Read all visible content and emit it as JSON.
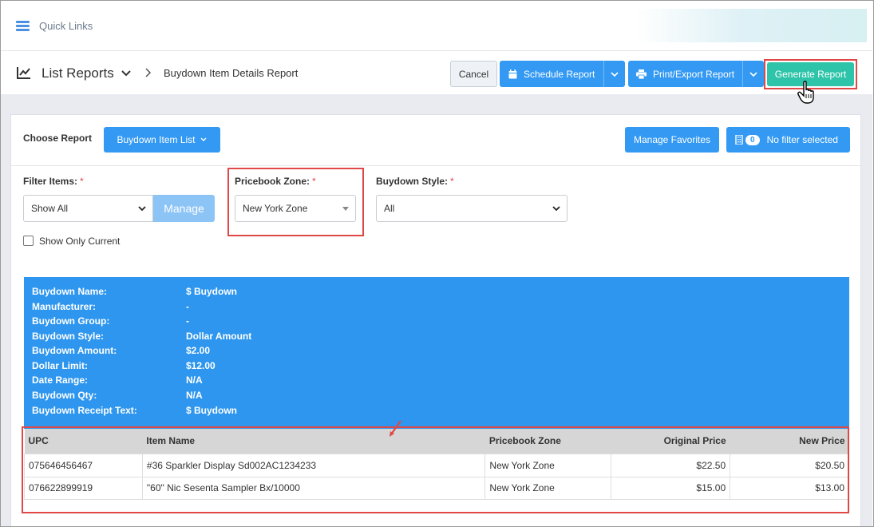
{
  "quick_links": {
    "label": "Quick Links"
  },
  "header": {
    "title": "List Reports",
    "breadcrumb": "Buydown Item Details Report",
    "cancel_label": "Cancel",
    "schedule_label": "Schedule Report",
    "print_label": "Print/Export Report",
    "generate_label": "Generate Report"
  },
  "toolbar": {
    "choose_label": "Choose Report",
    "choose_value": "Buydown Item List",
    "favorites_label": "Manage Favorites",
    "filter_count": "0",
    "filter_label": "No filter selected"
  },
  "filters": {
    "filter_items_label": "Filter Items:",
    "filter_items_value": "Show All",
    "manage_label": "Manage",
    "pricebook_zone_label": "Pricebook Zone:",
    "pricebook_zone_value": "New York Zone",
    "buydown_style_label": "Buydown Style:",
    "buydown_style_value": "All",
    "required_mark": "*",
    "show_only_current_label": "Show Only Current"
  },
  "buydown_info": [
    {
      "label": "Buydown Name:",
      "value": "$ Buydown"
    },
    {
      "label": "Manufacturer:",
      "value": "-"
    },
    {
      "label": "Buydown Group:",
      "value": "-"
    },
    {
      "label": "Buydown Style:",
      "value": "Dollar Amount"
    },
    {
      "label": "Buydown Amount:",
      "value": "$2.00"
    },
    {
      "label": "Dollar Limit:",
      "value": "$12.00"
    },
    {
      "label": "Date Range:",
      "value": "N/A"
    },
    {
      "label": "Buydown Qty:",
      "value": "N/A"
    },
    {
      "label": "Buydown Receipt Text:",
      "value": "$ Buydown"
    }
  ],
  "table": {
    "columns": [
      "UPC",
      "Item Name",
      "Pricebook Zone",
      "Original Price",
      "New Price"
    ],
    "rows": [
      [
        "075646456467",
        "#36 Sparkler Display Sd002AC1234233",
        "New York Zone",
        "$22.50",
        "$20.50"
      ],
      [
        "076622899919",
        "\"60\" Nic Sesenta Sampler Bx/10000",
        "New York Zone",
        "$15.00",
        "$13.00"
      ]
    ]
  },
  "colors": {
    "primary": "#3399f3",
    "generate": "#2ec4a9",
    "highlight": "#e04848",
    "info_panel": "#2e96ee"
  }
}
